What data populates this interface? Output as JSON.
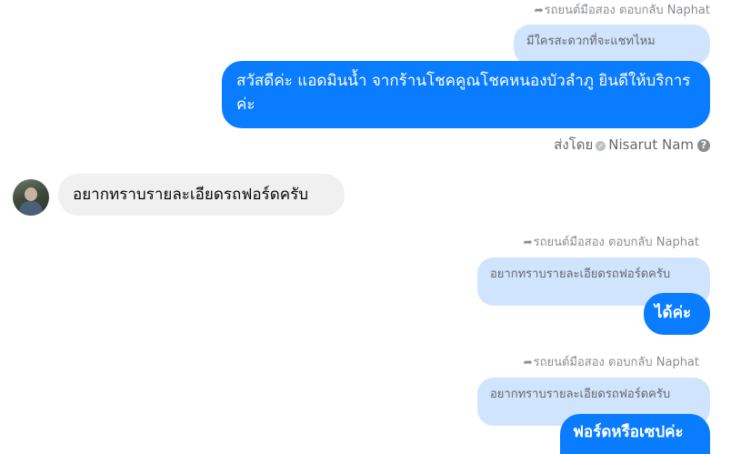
{
  "messages": {
    "reply1": {
      "label": "รถยนต์มือสอง ตอบกลับ Naphat",
      "quoted": "มีใครสะดวกที่จะแชทไหม"
    },
    "out1": {
      "text": "สวัสดีค่ะ แอดมินน้ำ จากร้านโชคคูณโชคหนองบัวลำภู ยินดีให้บริการค่ะ"
    },
    "sent_by": {
      "prefix": "ส่งโดย",
      "name": "Nisarut Nam"
    },
    "in1": {
      "text": "อยากทราบรายละเอียดรถฟอร์ดครับ"
    },
    "reply2": {
      "label": "รถยนต์มือสอง ตอบกลับ Naphat",
      "quoted": "อยากทราบรายละเอียดรถฟอร์ดครับ"
    },
    "out2": {
      "text": "ได้ค่ะ"
    },
    "reply3": {
      "label": "รถยนต์มือสอง ตอบกลับ Naphat",
      "quoted": "อยากทราบรายละเอียดรถฟอร์ดครับ"
    },
    "out3": {
      "text": "ฟอร์ดหรือเซปค่ะ"
    }
  },
  "icons": {
    "reply": "reply-arrow-icon",
    "verified": "check-icon",
    "help": "question-icon"
  },
  "colors": {
    "outgoing_bubble": "#0a7cff",
    "quoted_bubble": "#d1e4fd",
    "incoming_bubble": "#f0f0f0"
  }
}
